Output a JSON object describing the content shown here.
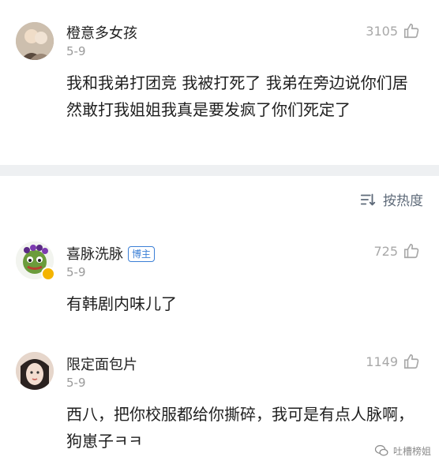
{
  "comments_top": {
    "username": "橙意多女孩",
    "date": "5-9",
    "likes": "3105",
    "text": "我和我弟打团竞 我被打死了 我弟在旁边说你们居然敢打我姐姐我真是要发疯了你们死定了"
  },
  "sort": {
    "label": "按热度"
  },
  "comments": [
    {
      "username": "喜脉洗脉",
      "badge": "博主",
      "date": "5-9",
      "likes": "725",
      "text": "有韩剧内味儿了"
    },
    {
      "username": "限定面包片",
      "date": "5-9",
      "likes": "1149",
      "text": "西八，把你校服都给你撕碎，我可是有点人脉啊，狗崽子ㅋㅋ"
    }
  ],
  "watermark": {
    "text": "吐槽榜姐"
  }
}
